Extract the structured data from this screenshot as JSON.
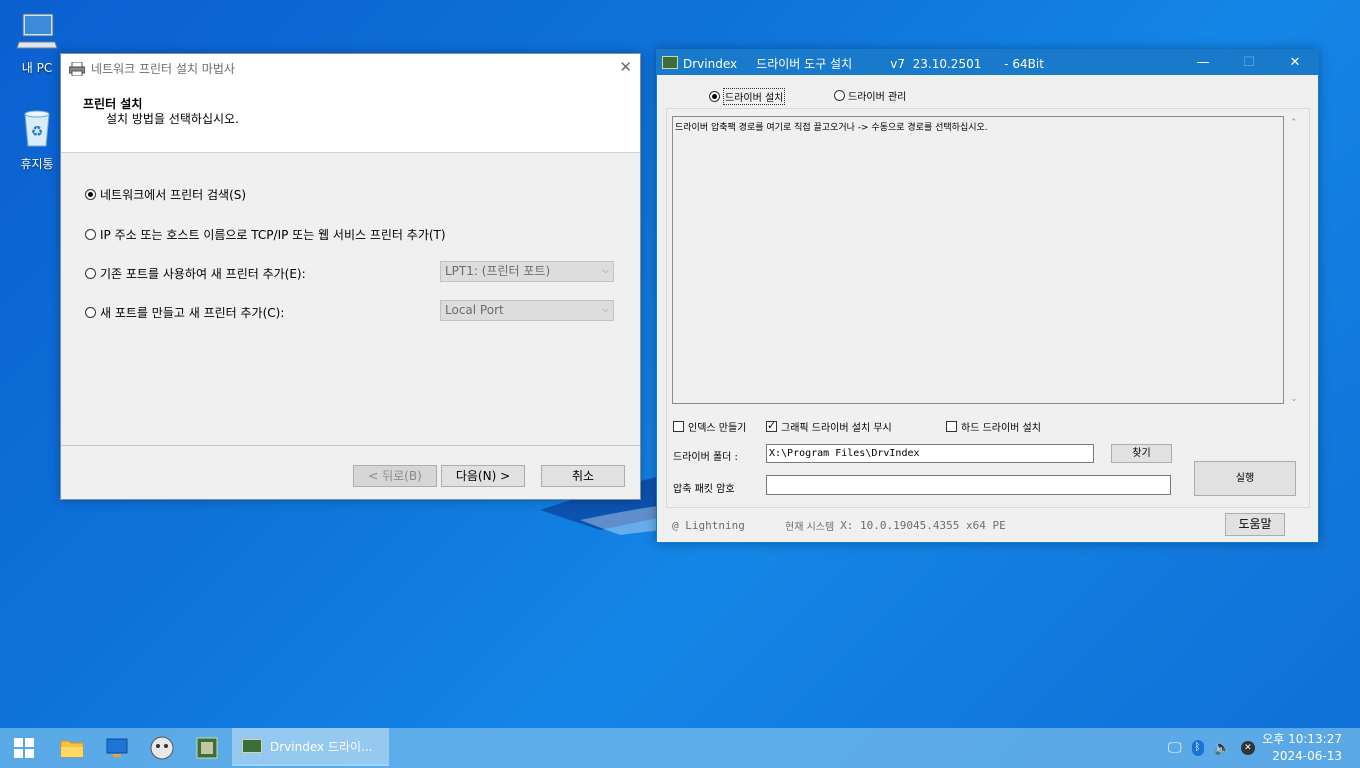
{
  "desktop": {
    "icons": [
      {
        "label": "내 PC"
      },
      {
        "label": "휴지통"
      }
    ]
  },
  "printer_wizard": {
    "title": "네트워크 프린터 설치 마법사",
    "heading": "프린터 설치",
    "subheading": "설치 방법을 선택하십시오.",
    "options": [
      {
        "label": "네트워크에서 프린터 검색(S)",
        "selected": true
      },
      {
        "label": "IP 주소 또는 호스트 이름으로 TCP/IP 또는 웹 서비스 프린터 추가(T)",
        "selected": false
      },
      {
        "label": "기존 포트를 사용하여 새 프린터 추가(E):",
        "selected": false
      },
      {
        "label": "새 포트를 만들고 새 프린터 추가(C):",
        "selected": false
      }
    ],
    "existing_port_value": "LPT1: (프린터 포트)",
    "new_port_value": "Local Port",
    "back_label": "< 뒤로(B)",
    "next_label": "다음(N) >",
    "cancel_label": "취소"
  },
  "drvindex": {
    "title": "Drvindex     드라이버 도구 설치          v7  23.10.2501      - 64Bit",
    "mode_install": "드라이버 설치",
    "mode_manage": "드라이버 관리",
    "message": "드라이버 압축팩 경로를 여기로 직접 끌고오거나 -> 수동으로 경로를 선택하십시오.",
    "chk_index": "인덱스 만들기",
    "chk_index_checked": false,
    "chk_graphic": "그래픽 드라이버 설치 무시",
    "chk_graphic_checked": true,
    "chk_hard": "하드 드라이버 설치",
    "chk_hard_checked": false,
    "folder_label": "드라이버 폴더 :",
    "folder_value": "X:\\Program Files\\DrvIndex",
    "browse_label": "찾기",
    "password_label": "압축 패킷 암호",
    "password_value": "",
    "run_label": "실행",
    "footer_author": "@ Lightning",
    "footer_system_label": "현재 시스템",
    "footer_system_value": "X: 10.0.19045.4355 x64  PE",
    "help_label": "도움말"
  },
  "taskbar": {
    "active_task": "Drvindex    드라이...",
    "time_prefix": "오후",
    "time": "10:13:27",
    "date": "2024-06-13"
  },
  "colors": {
    "titlebar_active": "#1979ca",
    "desktop_blue": "#0e73d9"
  }
}
